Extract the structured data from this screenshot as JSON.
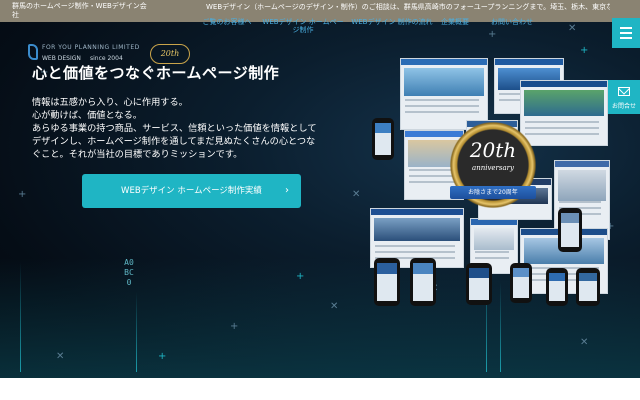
{
  "topbar": {
    "left_text": "群馬のホームページ制作・WEBデザイン会社",
    "right_text": "WEBデザイン（ホームページのデザイン・制作）のご相談は、群馬県高崎市のフォーユープランニングまで。埼玉、栃木、東京など各地域へもお伺い致し"
  },
  "logo": {
    "name": "FOR YOU PLANNING LIMITED",
    "sub": "WEB DESIGN",
    "since": "since 2004",
    "badge": "20th"
  },
  "nav": {
    "items": [
      "ご覧のお客様へ",
      "WEBデザイン ホームページ制作",
      "WEBデザイン 制作の流れ",
      "企業概要",
      "お問い合わせ"
    ]
  },
  "contact_tab": {
    "label": "お問合せ"
  },
  "hero": {
    "title": "心と価値をつなぐホームページ制作",
    "body": [
      "情報は五感から入り、心に作用する。",
      "心が動けば、価値となる。",
      "あらゆる事業の持つ商品、サービス、信頼といった価値を情報として",
      "デザインし、ホームページ制作を通してまだ見ぬたくさんの心とつな",
      "ぐこと。それが当社の目標でありミッションです。"
    ],
    "cta_label": "WEBデザイン ホームページ制作実績",
    "vertical_chars": "A0BC0"
  },
  "anniversary": {
    "number": "20th",
    "word": "anniversary",
    "ribbon": "お陰さまで20周年"
  },
  "colors": {
    "accent": "#1fb5c4",
    "nav_text": "#49aee0",
    "topbar_bg": "#8a8372"
  }
}
